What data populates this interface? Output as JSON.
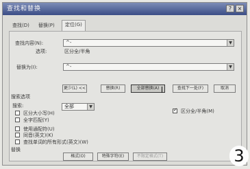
{
  "window": {
    "title": "查找和替换",
    "min_icon": "question-icon",
    "close_icon": "close-icon"
  },
  "tabs": [
    {
      "label": "查找(D)"
    },
    {
      "label": "替换(P)"
    },
    {
      "label": "定位(G)"
    }
  ],
  "find": {
    "label": "查找内容(N):",
    "value": "^-",
    "options_label": "选项:",
    "options_value": "区分全/半角"
  },
  "replace": {
    "label": "替换为(I):",
    "value": "^-"
  },
  "buttons": {
    "less": "更少(L) <<",
    "replace": "替换(R)",
    "replace_all": "全部替换(A)",
    "find_next": "查找下一处(F)",
    "cancel": "取消"
  },
  "search_options": {
    "heading": "搜索选项",
    "search_label": "搜索:",
    "search_value": "全部",
    "match_case": "区分大小写(H)",
    "whole_word": "全字匹配(Y)",
    "wildcards": "使用通配符(U)",
    "sounds_like": "同音(英文)(K)",
    "all_forms": "查找单词的所有形式(英文)(W)",
    "right_option": "区分全/半角(M)"
  },
  "replace_section": {
    "heading": "替换",
    "format_button": "格式(O)",
    "special_button": "特殊字符(E)",
    "no_format_button": "不限定格式(T)"
  },
  "corner_number": "3"
}
